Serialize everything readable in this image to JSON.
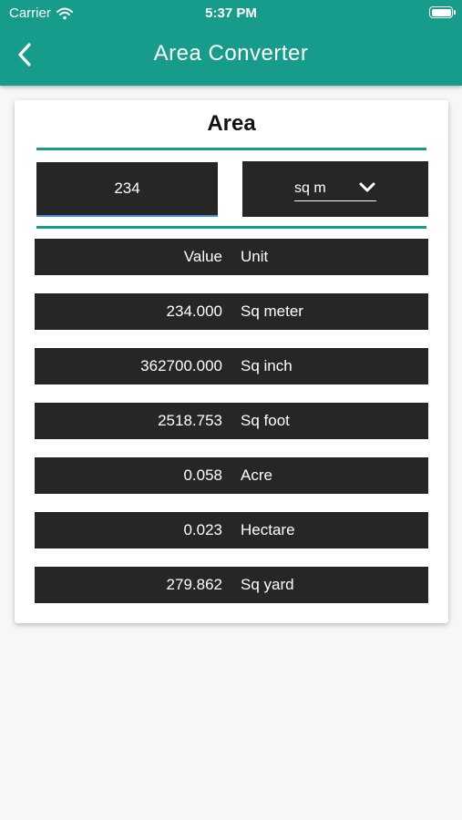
{
  "status": {
    "carrier": "Carrier",
    "time": "5:37 PM"
  },
  "header": {
    "title": "Area Converter"
  },
  "card": {
    "title": "Area",
    "input_value": "234",
    "selected_unit": "sq m",
    "table_header": {
      "value": "Value",
      "unit": "Unit"
    },
    "rows": [
      {
        "value": "234.000",
        "unit": "Sq meter"
      },
      {
        "value": "362700.000",
        "unit": "Sq inch"
      },
      {
        "value": "2518.753",
        "unit": "Sq foot"
      },
      {
        "value": "0.058",
        "unit": "Acre"
      },
      {
        "value": "0.023",
        "unit": "Hectare"
      },
      {
        "value": "279.862",
        "unit": "Sq yard"
      }
    ]
  },
  "colors": {
    "header": "#179c8c",
    "row": "#262626",
    "input_underline": "#3d8fd6"
  }
}
